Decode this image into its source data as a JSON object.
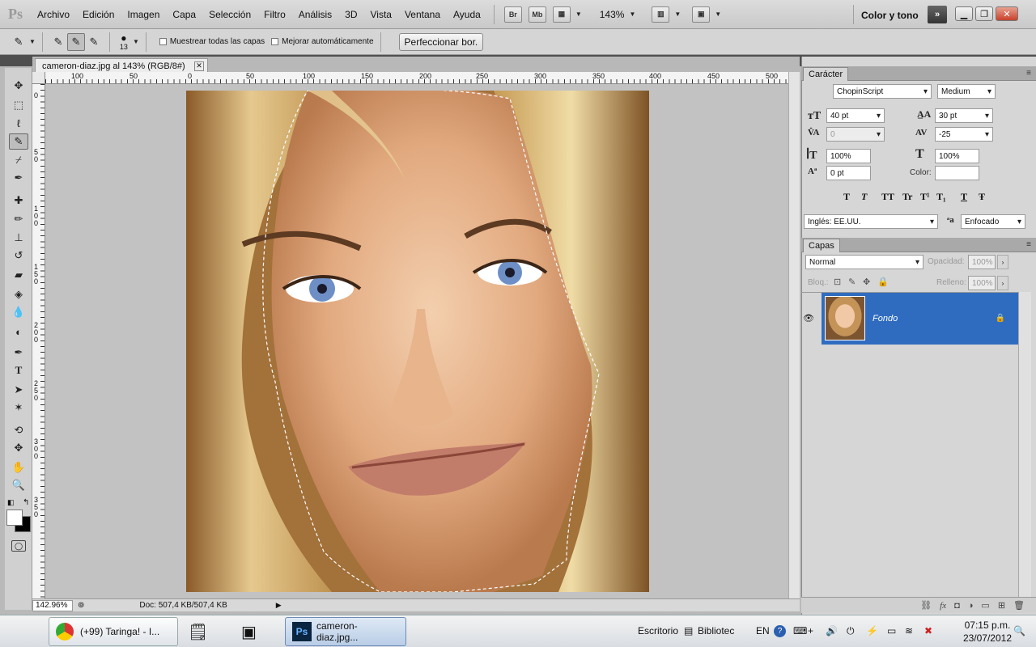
{
  "menubar": {
    "logo": "Ps",
    "items": [
      "Archivo",
      "Edición",
      "Imagen",
      "Capa",
      "Selección",
      "Filtro",
      "Análisis",
      "3D",
      "Vista",
      "Ventana",
      "Ayuda"
    ],
    "bridge_label": "Br",
    "minibridge_label": "Mb",
    "zoom_level": "143%",
    "workspace": "Color y tono",
    "workspace_arrow": "»"
  },
  "options": {
    "brush_size": "13",
    "sample_all_layers": "Muestrear todas las capas",
    "auto_enhance": "Mejorar automáticamente",
    "refine_edge": "Perfeccionar bor."
  },
  "document": {
    "tab_title": "cameron-diaz.jpg al 143% (RGB/8#)",
    "zoom": "142.96%",
    "doc_size": "Doc: 507,4 KB/507,4 KB",
    "ruler_top": [
      "100",
      "50",
      "0",
      "50",
      "100",
      "150",
      "200",
      "250",
      "300",
      "350",
      "400",
      "450",
      "500"
    ],
    "ruler_left": [
      "0",
      "5 0",
      "1 0 0",
      "1 5 0",
      "2 0 0",
      "2 5 0",
      "3 0 0",
      "3 5 0"
    ]
  },
  "character": {
    "tab": "Carácter",
    "font_family": "ChopinScript",
    "font_style": "Medium",
    "font_size": "40 pt",
    "leading": "30 pt",
    "kerning": "0",
    "tracking": "-25",
    "vertical_scale": "100%",
    "horizontal_scale": "100%",
    "baseline_shift": "0 pt",
    "color_label": "Color:",
    "language": "Inglés: EE.UU.",
    "antialias": "Enfocado",
    "style_buttons": [
      "T",
      "T",
      "TT",
      "Tr",
      "T¹",
      "T₁",
      "T",
      "Ŧ"
    ]
  },
  "layers": {
    "tab": "Capas",
    "blend_mode": "Normal",
    "opacity_label": "Opacidad:",
    "opacity": "100%",
    "lock_label": "Bloq.:",
    "fill_label": "Relleno:",
    "fill": "100%",
    "layer_name": "Fondo"
  },
  "taskbar": {
    "apps": [
      "(+99) Taringa! - I...",
      "cameron-diaz.jpg..."
    ],
    "desktop_label": "Escritorio",
    "library_label": "Bibliotec",
    "lang": "EN",
    "time": "07:15 p.m.",
    "date": "23/07/2012"
  }
}
